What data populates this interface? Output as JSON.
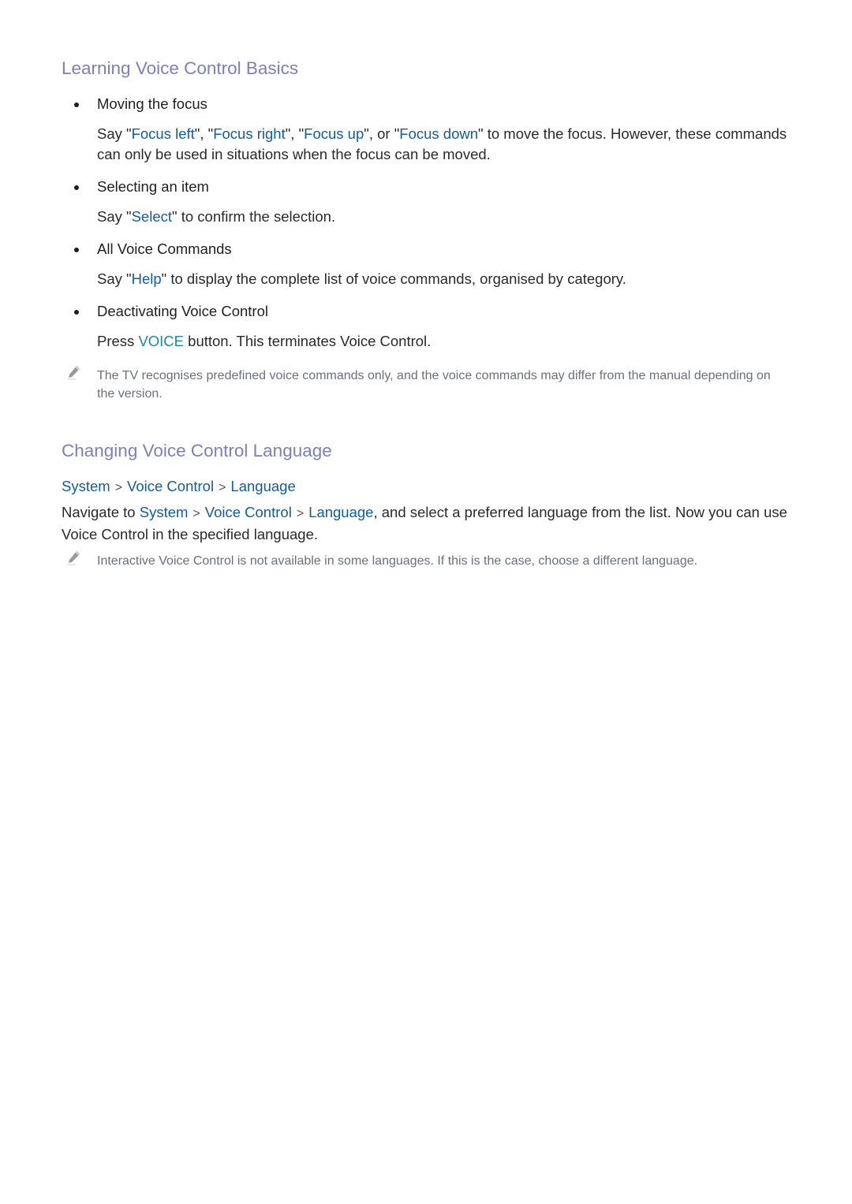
{
  "section1": {
    "title": "Learning Voice Control Basics",
    "items": [
      {
        "title": "Moving the focus",
        "body": {
          "p1": "Say \"",
          "c1": "Focus left",
          "p2": "\", \"",
          "c2": "Focus right",
          "p3": "\", \"",
          "c3": "Focus up",
          "p4": "\", or \"",
          "c4": "Focus down",
          "p5": "\" to move the focus. However, these commands can only be used in situations when the focus can be moved."
        }
      },
      {
        "title": "Selecting an item",
        "body": {
          "p1": "Say \"",
          "c1": "Select",
          "p2": "\" to confirm the selection."
        }
      },
      {
        "title": "All Voice Commands",
        "body": {
          "p1": "Say \"",
          "c1": "Help",
          "p2": "\" to display the complete list of voice commands, organised by category."
        }
      },
      {
        "title": "Deactivating Voice Control",
        "body": {
          "p1": "Press ",
          "c1": "VOICE",
          "p2": " button. This terminates Voice Control."
        }
      }
    ],
    "note": "The TV recognises predefined voice commands only, and the voice commands may differ from the manual depending on the version."
  },
  "section2": {
    "title": "Changing Voice Control Language",
    "breadcrumb": [
      "System",
      "Voice Control",
      "Language"
    ],
    "separator": ">",
    "body": {
      "p1": "Navigate to ",
      "c1": "System",
      "c2": "Voice Control",
      "c3": "Language",
      "p2": ", and select a preferred language from the list. Now you can use Voice Control in the specified language."
    },
    "note": "Interactive Voice Control is not available in some languages. If this is the case, choose a different language."
  },
  "colors": {
    "heading": "#7b7fc2",
    "link": "#0e5ea8",
    "button_label": "#1a8aa3",
    "note": "#6c6f80"
  },
  "icons": {
    "note": "pencil-icon"
  }
}
